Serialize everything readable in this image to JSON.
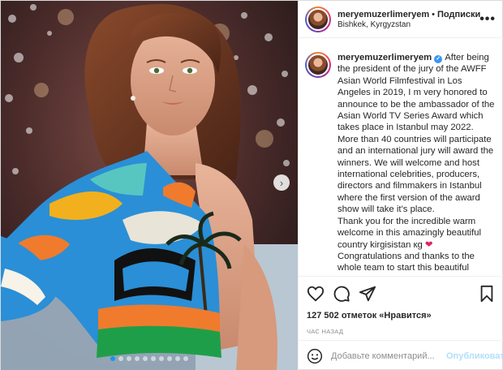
{
  "header": {
    "username": "meryemuzerlimeryem",
    "separator": "•",
    "follow_label": "Подписки",
    "location": "Bishkek, Kyrgyzstan",
    "more_glyph": "•••"
  },
  "caption": {
    "username": "meryemuzerlimeryem",
    "paragraphs": [
      "After being the president of the jury of the AWFF Asian World Filmfestival in Los Angeles in 2019, I m very honored to announce to be the ambassador of the Asian World TV Series Award which takes place in Istanbul may 2022.",
      "More than 40 countries will participate and an international jury will award the winners. We will welcome and host international celebrities, producers, directors and filmmakers in Istanbul where the first version of the award show will take it’s place.",
      "Thank you for the incredible warm welcome in this amazingly beautiful country kirgisistan ",
      "Congratulations and thanks to the whole team to start this beautiful journey together. Special thanks to"
    ],
    "flag_text": "кg",
    "heart": "❤"
  },
  "actions": {
    "likes_count": "127 502",
    "likes_suffix": "отметок «Нравится»",
    "time": "ЧАС НАЗАД"
  },
  "comment": {
    "placeholder": "Добавьте комментарий...",
    "publish_label": "Опубликовать"
  },
  "media": {
    "next_glyph": "›",
    "slide_count": 10,
    "active_slide": 1
  },
  "colors": {
    "accent": "#3897f0",
    "verified": "#3897f0",
    "publish_disabled": "#b2dffc",
    "muted": "#8e8e8e",
    "active_dot": "#1a95f0"
  },
  "icons": [
    "heart-icon",
    "comment-icon",
    "share-icon",
    "bookmark-icon",
    "more-icon",
    "smile-icon",
    "verified-icon",
    "chevron-right-icon"
  ]
}
